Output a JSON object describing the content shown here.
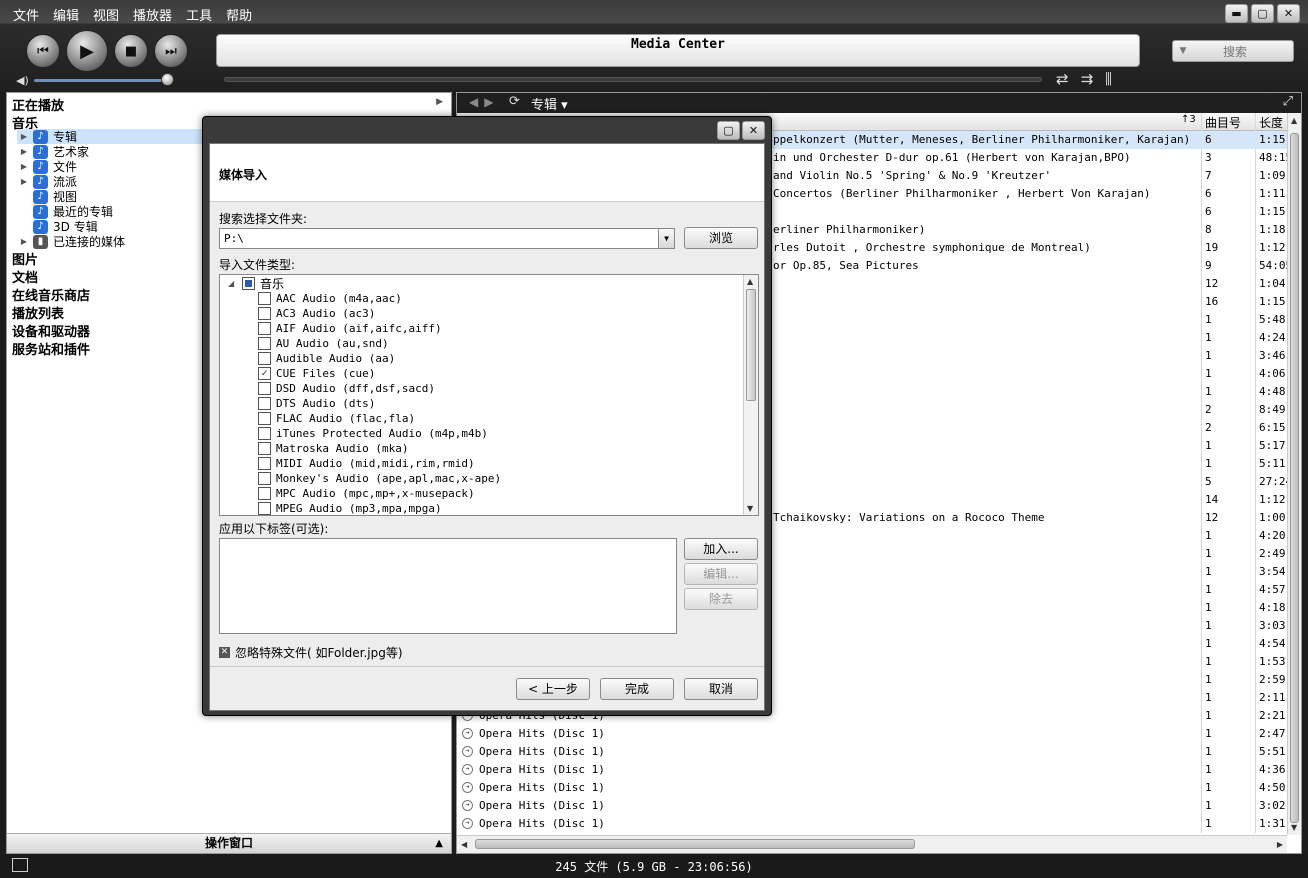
{
  "menu": [
    "文件",
    "编辑",
    "视图",
    "播放器",
    "工具",
    "帮助"
  ],
  "window_buttons": {
    "minimize": "▬",
    "maximize": "▢",
    "close": "✕"
  },
  "display_title": "Media Center",
  "search": {
    "placeholder": "搜索",
    "arrow": "▼"
  },
  "transport": {
    "prev": "⏮",
    "play": "▶",
    "stop": "■",
    "next": "⏭"
  },
  "volume_level": 0.95,
  "control_icons": [
    "⇄",
    "⇉",
    "⫼"
  ],
  "nav": {
    "now_playing": "正在播放",
    "music": "音乐",
    "music_children": [
      "专辑",
      "艺术家",
      "文件",
      "流派",
      "视图",
      "最近的专辑",
      "3D 专辑",
      "已连接的媒体"
    ],
    "sections": [
      "图片",
      "文档",
      "在线音乐商店",
      "播放列表",
      "设备和驱动器",
      "服务站和插件"
    ],
    "action_window": "操作窗口"
  },
  "right_toolbar": {
    "breadcrumb": "专辑 ▾"
  },
  "columns": {
    "sort": "↑3",
    "track_no": "曲目号",
    "length": "长度"
  },
  "tracks": [
    {
      "title": "ppelkonzert (Mutter, Meneses, Berliner Philharmoniker, Karajan)",
      "no": "6",
      "len": "1:15"
    },
    {
      "title": "in und Orchester D-dur op.61 (Herbert von Karajan,BPO)",
      "no": "3",
      "len": "48:15"
    },
    {
      "title": " and Violin No.5 'Spring' & No.9 'Kreutzer'",
      "no": "7",
      "len": "1:09"
    },
    {
      "title": "Concertos (Berliner Philharmoniker , Herbert Von Karajan)",
      "no": "6",
      "len": "1:11"
    },
    {
      "title": "",
      "no": "6",
      "len": "1:15"
    },
    {
      "title": "erliner Philharmoniker)",
      "no": "8",
      "len": "1:18"
    },
    {
      "title": "rles Dutoit , Orchestre symphonique de Montreal)",
      "no": "19",
      "len": "1:12"
    },
    {
      "title": "or Op.85, Sea Pictures",
      "no": "9",
      "len": "54:05"
    },
    {
      "title": "",
      "no": "12",
      "len": "1:04"
    },
    {
      "title": "",
      "no": "16",
      "len": "1:15"
    },
    {
      "title": "",
      "no": "1",
      "len": "5:48"
    },
    {
      "title": "",
      "no": "1",
      "len": "4:24"
    },
    {
      "title": "",
      "no": "1",
      "len": "3:46"
    },
    {
      "title": "",
      "no": "1",
      "len": "4:06"
    },
    {
      "title": "",
      "no": "1",
      "len": "4:48"
    },
    {
      "title": "",
      "no": "2",
      "len": "8:49"
    },
    {
      "title": "",
      "no": "2",
      "len": "6:15"
    },
    {
      "title": "",
      "no": "1",
      "len": "5:17"
    },
    {
      "title": "",
      "no": "1",
      "len": "5:11"
    },
    {
      "title": "",
      "no": "5",
      "len": "27:24"
    },
    {
      "title": "",
      "no": "14",
      "len": "1:12"
    },
    {
      "title": "Tchaikovsky: Variations on a Rococo Theme",
      "no": "12",
      "len": "1:00"
    },
    {
      "title": "",
      "no": "1",
      "len": "4:20"
    },
    {
      "title": "",
      "no": "1",
      "len": "2:49"
    },
    {
      "title": "",
      "no": "1",
      "len": "3:54"
    },
    {
      "title": "",
      "no": "1",
      "len": "4:57"
    },
    {
      "title": "",
      "no": "1",
      "len": "4:18"
    },
    {
      "title": "",
      "no": "1",
      "len": "3:03"
    },
    {
      "title": "",
      "no": "1",
      "len": "4:54"
    },
    {
      "title": "",
      "no": "1",
      "len": "1:53"
    },
    {
      "title": "",
      "no": "1",
      "len": "2:59"
    },
    {
      "title": "",
      "no": "1",
      "len": "2:11"
    },
    {
      "title": "Opera Hits (Disc 1)",
      "no": "1",
      "len": "2:21"
    },
    {
      "title": "Opera Hits (Disc 1)",
      "no": "1",
      "len": "2:47"
    },
    {
      "title": "Opera Hits (Disc 1)",
      "no": "1",
      "len": "5:51"
    },
    {
      "title": "Opera Hits (Disc 1)",
      "no": "1",
      "len": "4:36"
    },
    {
      "title": "Opera Hits (Disc 1)",
      "no": "1",
      "len": "4:50"
    },
    {
      "title": "Opera Hits (Disc 1)",
      "no": "1",
      "len": "3:02"
    },
    {
      "title": "Opera Hits (Disc 1)",
      "no": "1",
      "len": "1:31"
    }
  ],
  "status": "245 文件 (5.9 GB - 23:06:56)",
  "dialog": {
    "title": "媒体导入",
    "folder_label": "搜索选择文件夹:",
    "folder_value": "P:\\",
    "browse": "浏览",
    "types_label": "导入文件类型:",
    "root": "音乐",
    "types": [
      {
        "label": "AAC Audio (m4a,aac)",
        "checked": false
      },
      {
        "label": "AC3 Audio (ac3)",
        "checked": false
      },
      {
        "label": "AIF Audio (aif,aifc,aiff)",
        "checked": false
      },
      {
        "label": "AU Audio (au,snd)",
        "checked": false
      },
      {
        "label": "Audible Audio (aa)",
        "checked": false
      },
      {
        "label": "CUE Files (cue)",
        "checked": true
      },
      {
        "label": "DSD Audio (dff,dsf,sacd)",
        "checked": false
      },
      {
        "label": "DTS Audio (dts)",
        "checked": false
      },
      {
        "label": "FLAC Audio (flac,fla)",
        "checked": false
      },
      {
        "label": "iTunes Protected Audio (m4p,m4b)",
        "checked": false
      },
      {
        "label": "Matroska Audio (mka)",
        "checked": false
      },
      {
        "label": "MIDI Audio (mid,midi,rim,rmid)",
        "checked": false
      },
      {
        "label": "Monkey's Audio (ape,apl,mac,x-ape)",
        "checked": false
      },
      {
        "label": "MPC Audio (mpc,mp+,x-musepack)",
        "checked": false
      },
      {
        "label": "MPEG Audio (mp3,mpa,mpga)",
        "checked": false
      }
    ],
    "tags_label": "应用以下标签(可选):",
    "add": "加入...",
    "edit": "编辑...",
    "remove": "除去",
    "ignore_label": "忽略特殊文件( 如Folder.jpg等)",
    "back": "< 上一步",
    "finish": "完成",
    "cancel": "取消"
  }
}
